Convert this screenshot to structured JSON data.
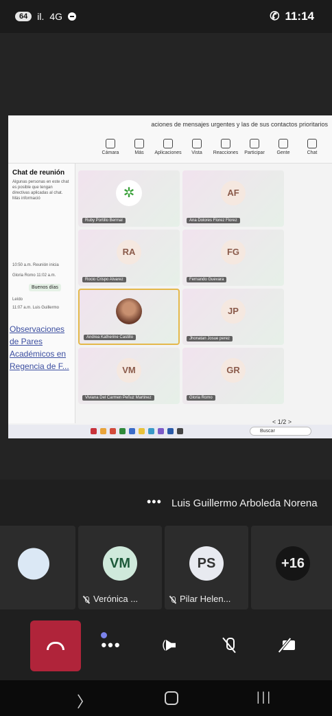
{
  "status_bar": {
    "time": "11:14",
    "battery": "64",
    "signal": "il.",
    "network": "4G"
  },
  "shared_screen": {
    "notice": "aciones de mensajes urgentes y las de sus contactos prioritarios",
    "toolbar": [
      {
        "label": "Chat",
        "icon": "chat-icon"
      },
      {
        "label": "Gente",
        "icon": "people-icon"
      },
      {
        "label": "Participar",
        "icon": "raise-hand-icon"
      },
      {
        "label": "Reacciones",
        "icon": "reactions-icon"
      },
      {
        "label": "Vista",
        "icon": "view-icon"
      },
      {
        "label": "Aplicaciones",
        "icon": "apps-icon"
      },
      {
        "label": "Más",
        "icon": "more-icon"
      },
      {
        "label": "Cámara",
        "icon": "camera-icon"
      }
    ],
    "chat": {
      "title": "Chat de reunión",
      "description": "Algunas personas en este chat es posible que tengan directivas aplicadas al chat. Más informació",
      "msg1": "10:50 a.m.  Reunión inicia",
      "msg2": "Gloria Romo  11:02 a.m.",
      "bubble": "Buenos días",
      "msg3": "Leído",
      "msg4": "11:07 a.m.  Luis Guillermo",
      "link": "Observaciones de Pares Académicos en Regencia de F..."
    },
    "tiles": [
      {
        "initials": "AF",
        "name": "Ana Dolores Florez Florez"
      },
      {
        "initials": "",
        "name": "Ruby Portillo Bermal"
      },
      {
        "initials": "FG",
        "name": "Fernando Guevara"
      },
      {
        "initials": "RA",
        "name": "Rocio Crispo Alvarez"
      },
      {
        "initials": "JP",
        "name": "Jhonatan Josue perez"
      },
      {
        "initials": "",
        "name": "Andrea Katherine Castillo"
      },
      {
        "initials": "GR",
        "name": "Gloria Romo"
      },
      {
        "initials": "VM",
        "name": "Viviana Del Carmen Peñuz Martinez"
      }
    ],
    "page_indicator": "< 1/2 >",
    "taskbar_search": "Buscar"
  },
  "presenter": {
    "name": "Luis Guillermo Arboleda Norena",
    "more": "•••"
  },
  "participants": [
    {
      "initials": "+16",
      "label": ""
    },
    {
      "initials": "PS",
      "label": "Pilar Helen..."
    },
    {
      "initials": "VM",
      "label": "Verónica ..."
    },
    {
      "initials": "",
      "label": ""
    }
  ],
  "colors": {
    "leave": "#b0243a",
    "accent": "#7b83eb",
    "avatar_ps": "#e8eaf0",
    "avatar_vm": "#cfe9db"
  }
}
